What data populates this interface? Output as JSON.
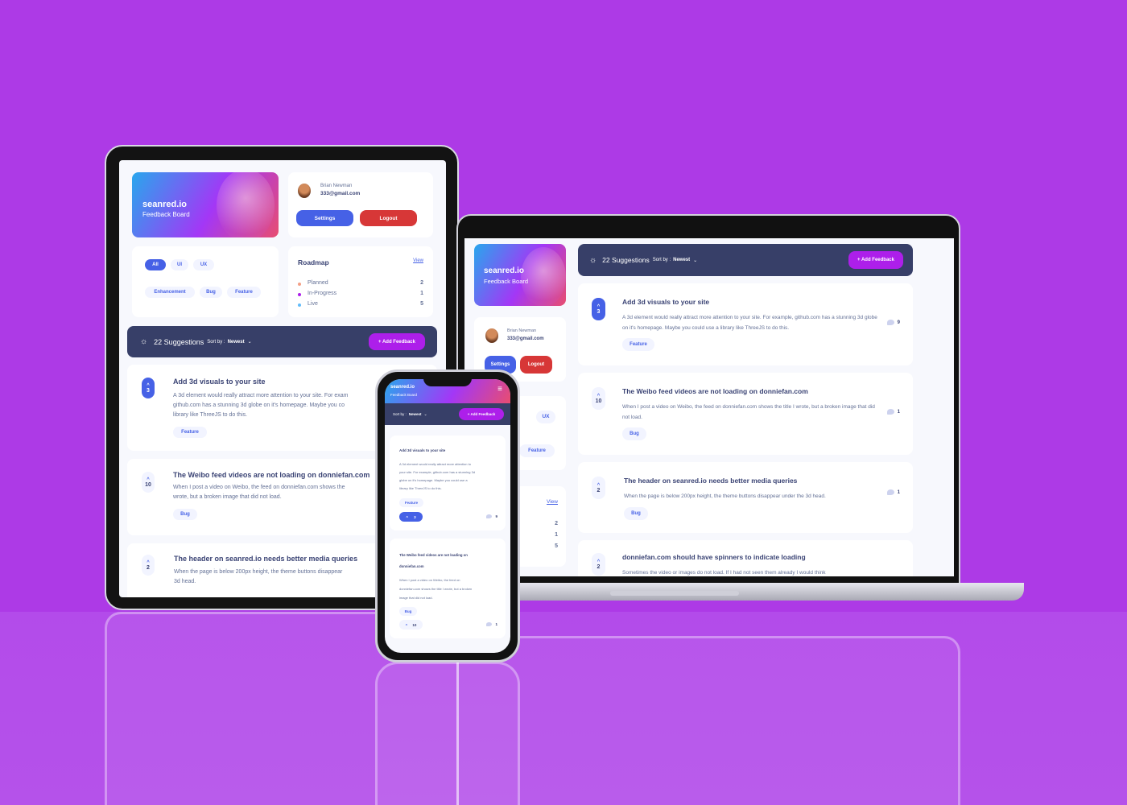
{
  "colors": {
    "background": "#ad3ae6",
    "accent_blue": "#4661e6",
    "accent_purple": "#ad1fea",
    "danger": "#d73737",
    "dark_bar": "#373f68",
    "planned": "#f49f85",
    "in_progress": "#ad1fea",
    "live": "#62bcfa"
  },
  "brand": {
    "name": "seanred.io",
    "subtitle": "Feedback Board"
  },
  "user": {
    "name": "Brian Newman",
    "email": "333@gmail.com"
  },
  "buttons": {
    "settings": "Settings",
    "logout": "Logout",
    "add_feedback": "+ Add Feedback"
  },
  "filters": [
    "All",
    "UI",
    "UX",
    "Enhancement",
    "Bug",
    "Feature"
  ],
  "roadmap": {
    "title": "Roadmap",
    "view": "View",
    "items": [
      {
        "label": "Planned",
        "count": "2"
      },
      {
        "label": "In-Progress",
        "count": "1"
      },
      {
        "label": "Live",
        "count": "5"
      }
    ]
  },
  "toolbar": {
    "count_text": "22 Suggestions",
    "sort_label": "Sort by :",
    "sort_value": "Newest",
    "icon": "lightbulb-icon"
  },
  "suggestions": [
    {
      "title": "Add 3d visuals to your site",
      "desc": "A 3d element would really attract more attention to your site. For example, github.com has a stunning 3d globe on it's homepage. Maybe you could use a library like ThreeJS to do this.",
      "tag": "Feature",
      "votes": "3",
      "comments": "9"
    },
    {
      "title": "The Weibo feed videos are not loading on donniefan.com",
      "desc": "When I post a video on Weibo, the feed on donniefan.com shows the title I wrote, but a broken image that did not load.",
      "tag": "Bug",
      "votes": "10",
      "comments": "1"
    },
    {
      "title": "The header on seanred.io needs better media queries",
      "desc": "When the page is below 200px height, the theme buttons disappear under the 3d head.",
      "tag": "Bug",
      "votes": "2",
      "comments": "1"
    },
    {
      "title": "donniefan.com should have spinners to indicate loading",
      "desc": "Sometimes the video or images do not load. If I had not seen them already I would think",
      "tag": "",
      "votes": "2",
      "comments": ""
    }
  ],
  "tablet": {
    "descs": [
      "A 3d element would really attract more attention to your site. For exam",
      "github.com has a stunning 3d globe on it's homepage. Maybe you co",
      "library like ThreeJS to do this.",
      "When I post a video on Weibo, the feed on donniefan.com shows the",
      "wrote, but a broken image that did not load.",
      "When the page is below 200px height, the theme buttons disappear",
      "3d head."
    ],
    "titles": [
      "Add 3d visuals to your site",
      "The Weibo feed videos are not loading on donniefan.com",
      "The header on seanred.io needs better media queries"
    ]
  },
  "phone": {
    "sort_label": "Sort by :",
    "cards": [
      {
        "title": "Add 3d visuals to your site",
        "lines": [
          "A 3d element would really attract more attention to",
          "your site. For example, github.com has a stunning 3d",
          "globe on it's homepage. Maybe you could use a",
          "library like ThreeJS to do this."
        ],
        "tag": "Feature",
        "votes": "3",
        "comments": "9"
      },
      {
        "title_lines": [
          "The Weibo feed videos are not loading on",
          "donniefan.com"
        ],
        "lines": [
          "When I post a video on Weibo, the feed on",
          "donniefan.com shows the title I wrote, but a broken",
          "image that did not load."
        ],
        "tag": "Bug",
        "votes": "10",
        "comments": "1"
      }
    ]
  }
}
